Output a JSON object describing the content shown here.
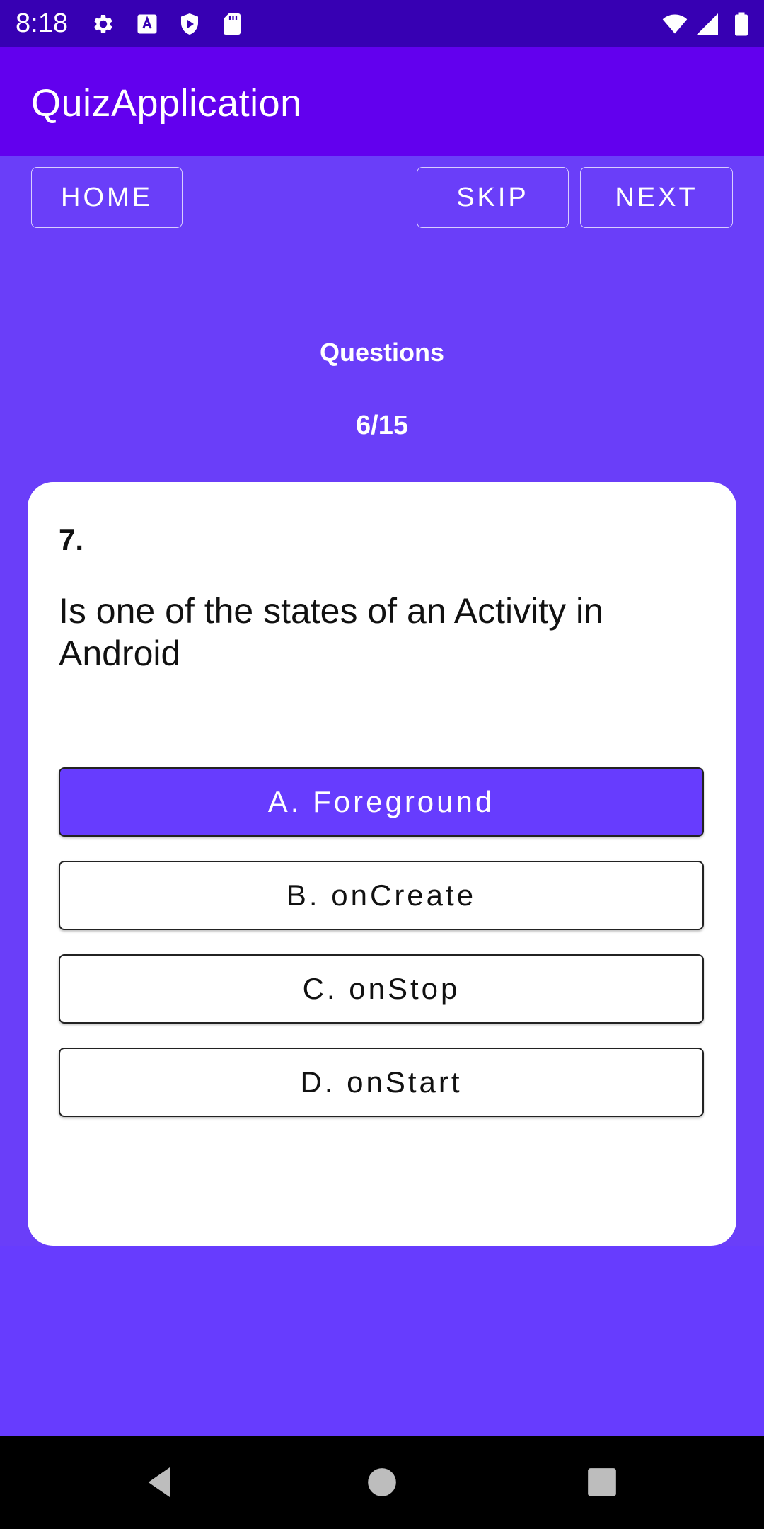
{
  "status_bar": {
    "time": "8:18",
    "icons": [
      "gear-icon",
      "text-a-icon",
      "play-shield-icon",
      "sd-card-icon",
      "wifi-icon",
      "signal-icon",
      "battery-icon"
    ]
  },
  "app_bar": {
    "title": "QuizApplication"
  },
  "nav_buttons": {
    "home": "HOME",
    "skip": "SKIP",
    "next": "NEXT"
  },
  "progress": {
    "label": "Questions",
    "count": "6/15"
  },
  "question": {
    "number": "7.",
    "text": "Is one of the states of an Activity in Android",
    "options": [
      {
        "label": "A. Foreground",
        "selected": true
      },
      {
        "label": "B. onCreate",
        "selected": false
      },
      {
        "label": "C. onStop",
        "selected": false
      },
      {
        "label": "D. onStart",
        "selected": false
      }
    ]
  },
  "system_nav": [
    "back-icon",
    "home-icon",
    "recents-icon"
  ],
  "colors": {
    "status_bar": "#3700b3",
    "app_bar": "#6200ee",
    "background": "#673cfe",
    "selected_option": "#673cfe",
    "card": "#ffffff"
  }
}
